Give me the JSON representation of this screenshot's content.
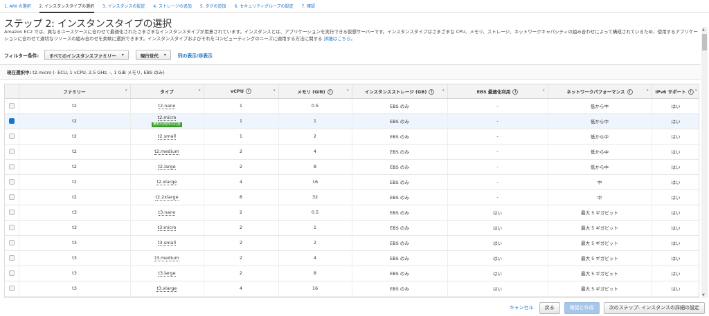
{
  "steps": [
    {
      "label": "1. AMI の選択"
    },
    {
      "label": "2. インスタンスタイプの選択"
    },
    {
      "label": "3. インスタンスの設定"
    },
    {
      "label": "4. ストレージの追加"
    },
    {
      "label": "5. タグの追加"
    },
    {
      "label": "6. セキュリティグループの設定"
    },
    {
      "label": "7. 確認"
    }
  ],
  "page": {
    "title": "ステップ 2: インスタンスタイプの選択",
    "description": "Amazon EC2 では、異なるユースケースに合わせて最適化されたさまざまなインスタンスタイプが用意されています。インスタンスとは、アプリケーションを実行できる仮想サーバーです。インスタンスタイプはさまざまな CPU、メモリ、ストレージ、ネットワークキャパシティの組み合わせによって構成されているため、使用するアプリケーションに合わせて適切なリソースの組み合わせを柔軟に選択できます。インスタンスタイプおよびそれをコンピューティングのニーズに適用する方法に関する",
    "details_link": "詳細はこちら。"
  },
  "filter": {
    "label": "フィルター条件:",
    "family_select": "すべてのインスタンスファミリー",
    "generation_select": "現行世代",
    "column_toggle": "列の表示/非表示"
  },
  "current_selection": {
    "label": "現在選択中:",
    "value": "t2.micro (- ECU, 1 vCPU, 2.5 GHz, -, 1 GiB メモリ, EBS のみ)"
  },
  "table": {
    "columns": {
      "family": "ファミリー",
      "type": "タイプ",
      "vcpu": "vCPU",
      "memory": "メモリ (GiB)",
      "storage": "インスタンスストレージ (GB)",
      "ebs": "EBS 最適化利用",
      "network": "ネットワークパフォーマンス",
      "ipv6": "IPv6 サポート"
    },
    "info_glyph": "i",
    "free_tier_badge": "無料利用枠の対象",
    "rows": [
      {
        "family": "t2",
        "type": "t2.nano",
        "vcpu": "1",
        "memory": "0.5",
        "storage": "EBS のみ",
        "ebs": "-",
        "network": "低から中",
        "ipv6": "はい",
        "selected": false
      },
      {
        "family": "t2",
        "type": "t2.micro",
        "vcpu": "1",
        "memory": "1",
        "storage": "EBS のみ",
        "ebs": "-",
        "network": "低から中",
        "ipv6": "はい",
        "selected": true,
        "free_tier": true
      },
      {
        "family": "t2",
        "type": "t2.small",
        "vcpu": "1",
        "memory": "2",
        "storage": "EBS のみ",
        "ebs": "-",
        "network": "低から中",
        "ipv6": "はい",
        "selected": false
      },
      {
        "family": "t2",
        "type": "t2.medium",
        "vcpu": "2",
        "memory": "4",
        "storage": "EBS のみ",
        "ebs": "-",
        "network": "低から中",
        "ipv6": "はい",
        "selected": false
      },
      {
        "family": "t2",
        "type": "t2.large",
        "vcpu": "2",
        "memory": "8",
        "storage": "EBS のみ",
        "ebs": "-",
        "network": "低から中",
        "ipv6": "はい",
        "selected": false
      },
      {
        "family": "t2",
        "type": "t2.xlarge",
        "vcpu": "4",
        "memory": "16",
        "storage": "EBS のみ",
        "ebs": "-",
        "network": "中",
        "ipv6": "はい",
        "selected": false
      },
      {
        "family": "t2",
        "type": "t2.2xlarge",
        "vcpu": "8",
        "memory": "32",
        "storage": "EBS のみ",
        "ebs": "-",
        "network": "中",
        "ipv6": "はい",
        "selected": false
      },
      {
        "family": "t3",
        "type": "t3.nano",
        "vcpu": "2",
        "memory": "0.5",
        "storage": "EBS のみ",
        "ebs": "はい",
        "network": "最大 5 ギガビット",
        "ipv6": "はい",
        "selected": false
      },
      {
        "family": "t3",
        "type": "t3.micro",
        "vcpu": "2",
        "memory": "1",
        "storage": "EBS のみ",
        "ebs": "はい",
        "network": "最大 5 ギガビット",
        "ipv6": "はい",
        "selected": false
      },
      {
        "family": "t3",
        "type": "t3.small",
        "vcpu": "2",
        "memory": "2",
        "storage": "EBS のみ",
        "ebs": "はい",
        "network": "最大 5 ギガビット",
        "ipv6": "はい",
        "selected": false
      },
      {
        "family": "t3",
        "type": "t3.medium",
        "vcpu": "2",
        "memory": "4",
        "storage": "EBS のみ",
        "ebs": "はい",
        "network": "最大 5 ギガビット",
        "ipv6": "はい",
        "selected": false
      },
      {
        "family": "t3",
        "type": "t3.large",
        "vcpu": "2",
        "memory": "8",
        "storage": "EBS のみ",
        "ebs": "はい",
        "network": "最大 5 ギガビット",
        "ipv6": "はい",
        "selected": false
      },
      {
        "family": "t3",
        "type": "t3.xlarge",
        "vcpu": "4",
        "memory": "16",
        "storage": "EBS のみ",
        "ebs": "はい",
        "network": "最大 5 ギガビット",
        "ipv6": "はい",
        "selected": false
      }
    ]
  },
  "footer": {
    "cancel": "キャンセル",
    "back": "戻る",
    "review_launch": "確認と作成",
    "next": "次のステップ: インスタンスの詳細の設定"
  },
  "colors": {
    "link": "#1a73c9",
    "selected_row": "#eef5fd",
    "free_badge": "#3a9d2a",
    "disabled_primary": "#a8c6ea"
  }
}
